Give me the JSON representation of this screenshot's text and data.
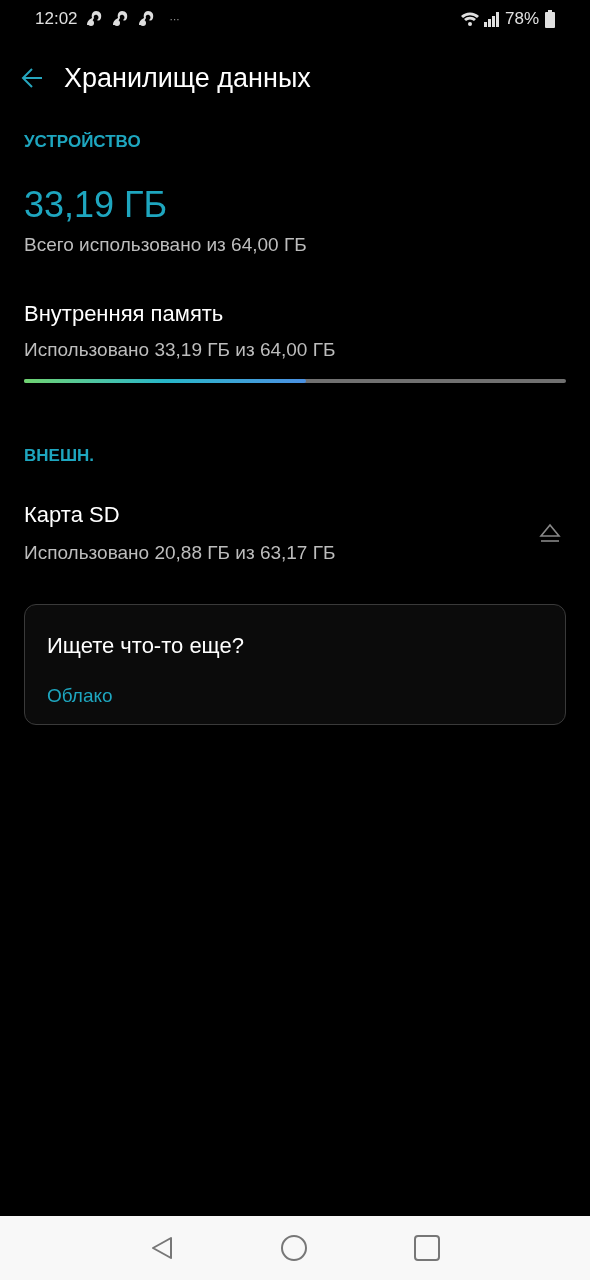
{
  "status_bar": {
    "time": "12:02",
    "more": "···",
    "battery": "78%"
  },
  "header": {
    "title": "Хранилище данных"
  },
  "device": {
    "section": "УСТРОЙСТВО",
    "used": "33,19 ГБ",
    "summary": "Всего использовано из 64,00 ГБ",
    "storages": [
      {
        "name": "Внутренняя память",
        "usage": "Использовано 33,19 ГБ из 64,00 ГБ",
        "level": 0.52
      }
    ]
  },
  "external": {
    "section": "ВНЕШН.",
    "cards": [
      {
        "name": "Карта SD",
        "usage": "Использовано 20,88 ГБ из 63,17 ГБ"
      }
    ]
  },
  "suggestion": {
    "title": "Ищете что-то еще?",
    "link": "Облако"
  }
}
